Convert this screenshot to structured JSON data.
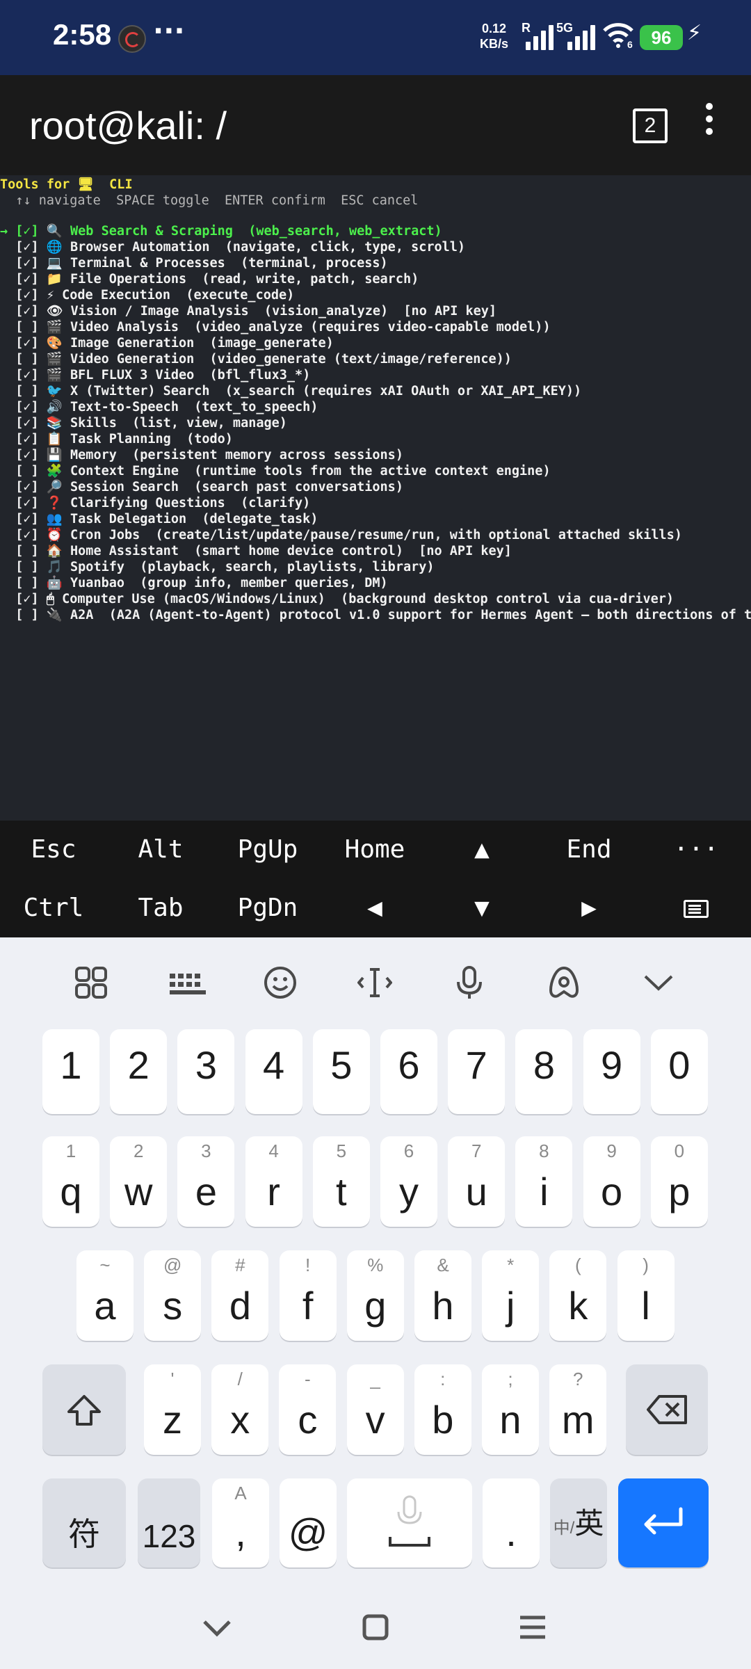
{
  "status_bar": {
    "time": "2:58",
    "more": "···",
    "net_speed_value": "0.12",
    "net_speed_unit": "KB/s",
    "roaming": "R",
    "network_type": "5G",
    "wifi_sub": "6",
    "battery": "96"
  },
  "header": {
    "title": "root@kali: /",
    "session_count": "2"
  },
  "terminal": {
    "heading_prefix": "Tools for ",
    "heading_icon": "🖥",
    "heading_suffix": "  CLI",
    "instructions": "  ↑↓ navigate  SPACE toggle  ENTER confirm  ESC cancel",
    "tools": [
      {
        "cursor": "→ ",
        "state": "[✓]",
        "icon": "🔍",
        "text": "Web Search & Scraping  (web_search, web_extract)"
      },
      {
        "cursor": "  ",
        "state": "[✓]",
        "icon": "🌐",
        "text": "Browser Automation  (navigate, click, type, scroll)"
      },
      {
        "cursor": "  ",
        "state": "[✓]",
        "icon": "💻",
        "text": "Terminal & Processes  (terminal, process)"
      },
      {
        "cursor": "  ",
        "state": "[✓]",
        "icon": "📁",
        "text": "File Operations  (read, write, patch, search)"
      },
      {
        "cursor": "  ",
        "state": "[✓]",
        "icon": "⚡",
        "text": "Code Execution  (execute_code)"
      },
      {
        "cursor": "  ",
        "state": "[✓]",
        "icon": "👁",
        "text": "Vision / Image Analysis  (vision_analyze)  [no API key]"
      },
      {
        "cursor": "  ",
        "state": "[ ]",
        "icon": "🎬",
        "text": "Video Analysis  (video_analyze (requires video-capable model))"
      },
      {
        "cursor": "  ",
        "state": "[✓]",
        "icon": "🎨",
        "text": "Image Generation  (image_generate)"
      },
      {
        "cursor": "  ",
        "state": "[ ]",
        "icon": "🎬",
        "text": "Video Generation  (video_generate (text/image/reference))"
      },
      {
        "cursor": "  ",
        "state": "[✓]",
        "icon": "🎬",
        "text": "BFL FLUX 3 Video  (bfl_flux3_*)"
      },
      {
        "cursor": "  ",
        "state": "[ ]",
        "icon": "🐦",
        "text": "X (Twitter) Search  (x_search (requires xAI OAuth or XAI_API_KEY))"
      },
      {
        "cursor": "  ",
        "state": "[✓]",
        "icon": "🔊",
        "text": "Text-to-Speech  (text_to_speech)"
      },
      {
        "cursor": "  ",
        "state": "[✓]",
        "icon": "📚",
        "text": "Skills  (list, view, manage)"
      },
      {
        "cursor": "  ",
        "state": "[✓]",
        "icon": "📋",
        "text": "Task Planning  (todo)"
      },
      {
        "cursor": "  ",
        "state": "[✓]",
        "icon": "💾",
        "text": "Memory  (persistent memory across sessions)"
      },
      {
        "cursor": "  ",
        "state": "[ ]",
        "icon": "🧩",
        "text": "Context Engine  (runtime tools from the active context engine)"
      },
      {
        "cursor": "  ",
        "state": "[✓]",
        "icon": "🔎",
        "text": "Session Search  (search past conversations)"
      },
      {
        "cursor": "  ",
        "state": "[✓]",
        "icon": "❓",
        "text": "Clarifying Questions  (clarify)"
      },
      {
        "cursor": "  ",
        "state": "[✓]",
        "icon": "👥",
        "text": "Task Delegation  (delegate_task)"
      },
      {
        "cursor": "  ",
        "state": "[✓]",
        "icon": "⏰",
        "text": "Cron Jobs  (create/list/update/pause/resume/run, with optional attached skills)"
      },
      {
        "cursor": "  ",
        "state": "[ ]",
        "icon": "🏠",
        "text": "Home Assistant  (smart home device control)  [no API key]"
      },
      {
        "cursor": "  ",
        "state": "[ ]",
        "icon": "🎵",
        "text": "Spotify  (playback, search, playlists, library)"
      },
      {
        "cursor": "  ",
        "state": "[ ]",
        "icon": "🤖",
        "text": "Yuanbao  (group info, member queries, DM)"
      },
      {
        "cursor": "  ",
        "state": "[✓]",
        "icon": "🖱",
        "text": "Computer Use (macOS/Windows/Linux)  (background desktop control via cua-driver)"
      },
      {
        "cursor": "  ",
        "state": "[ ]",
        "icon": "🔌",
        "text": "A2A  (A2A (Agent-to-Agent) protocol v1.0 support for Hermes Agent — both directions of t"
      }
    ]
  },
  "extra_keys": {
    "row1": [
      "Esc",
      "Alt",
      "PgUp",
      "Home",
      "▲",
      "End",
      "···"
    ],
    "row2": [
      "Ctrl",
      "Tab",
      "PgDn",
      "◀",
      "▼",
      "▶"
    ]
  },
  "keyboard": {
    "numbers": [
      "1",
      "2",
      "3",
      "4",
      "5",
      "6",
      "7",
      "8",
      "9",
      "0"
    ],
    "row_q": [
      {
        "k": "q",
        "h": "1"
      },
      {
        "k": "w",
        "h": "2"
      },
      {
        "k": "e",
        "h": "3"
      },
      {
        "k": "r",
        "h": "4"
      },
      {
        "k": "t",
        "h": "5"
      },
      {
        "k": "y",
        "h": "6"
      },
      {
        "k": "u",
        "h": "7"
      },
      {
        "k": "i",
        "h": "8"
      },
      {
        "k": "o",
        "h": "9"
      },
      {
        "k": "p",
        "h": "0"
      }
    ],
    "row_a": [
      {
        "k": "a",
        "h": "~"
      },
      {
        "k": "s",
        "h": "@"
      },
      {
        "k": "d",
        "h": "#"
      },
      {
        "k": "f",
        "h": "!"
      },
      {
        "k": "g",
        "h": "%"
      },
      {
        "k": "h",
        "h": "&"
      },
      {
        "k": "j",
        "h": "*"
      },
      {
        "k": "k",
        "h": "("
      },
      {
        "k": "l",
        "h": ")"
      }
    ],
    "row_z": [
      {
        "k": "z",
        "h": "'"
      },
      {
        "k": "x",
        "h": "/"
      },
      {
        "k": "c",
        "h": "-"
      },
      {
        "k": "v",
        "h": "_"
      },
      {
        "k": "b",
        "h": ":"
      },
      {
        "k": "n",
        "h": ";"
      },
      {
        "k": "m",
        "h": "?"
      }
    ],
    "symbols_label": "符",
    "numbers_label": "123",
    "comma_label": ",",
    "comma_hint": "A",
    "at_label": "@",
    "period_label": ".",
    "lang_small": "中/",
    "lang_big": "英"
  },
  "colors": {
    "status_bar": "#182a5a",
    "terminal_bg": "#22252b",
    "selected_row": "#4cf04c",
    "heading": "#f5e642",
    "enter_key": "#1677ff"
  }
}
